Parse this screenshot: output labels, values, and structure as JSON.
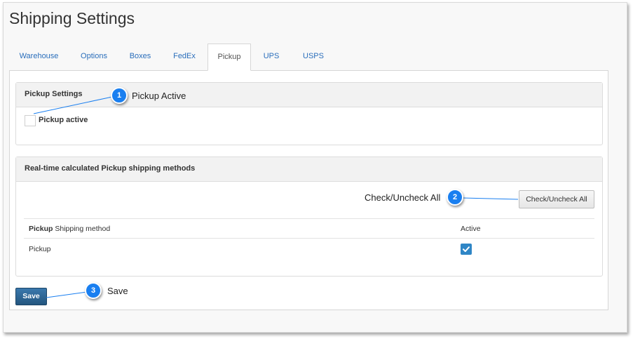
{
  "page": {
    "title": "Shipping Settings"
  },
  "tabs": [
    {
      "label": "Warehouse",
      "active": false
    },
    {
      "label": "Options",
      "active": false
    },
    {
      "label": "Boxes",
      "active": false
    },
    {
      "label": "FedEx",
      "active": false
    },
    {
      "label": "Pickup",
      "active": true
    },
    {
      "label": "UPS",
      "active": false
    },
    {
      "label": "USPS",
      "active": false
    }
  ],
  "pickup_settings": {
    "heading": "Pickup Settings",
    "pickup_active_label": "Pickup active",
    "pickup_active_checked": false
  },
  "methods_panel": {
    "heading": "Real-time calculated Pickup shipping methods",
    "check_all_label": "Check/Uncheck All",
    "table": {
      "header_method_bold": "Pickup",
      "header_method_rest": " Shipping method",
      "header_active": "Active",
      "rows": [
        {
          "method": "Pickup",
          "active": true
        }
      ]
    }
  },
  "save_label": "Save",
  "callouts": [
    {
      "number": "1",
      "text": "Pickup Active"
    },
    {
      "number": "2",
      "text": "Check/Uncheck All"
    },
    {
      "number": "3",
      "text": "Save"
    }
  ],
  "colors": {
    "accent": "#1a7ff0",
    "link": "#2a6ebb",
    "save_button": "#2d6694",
    "checkbox_checked": "#2f86c6"
  }
}
